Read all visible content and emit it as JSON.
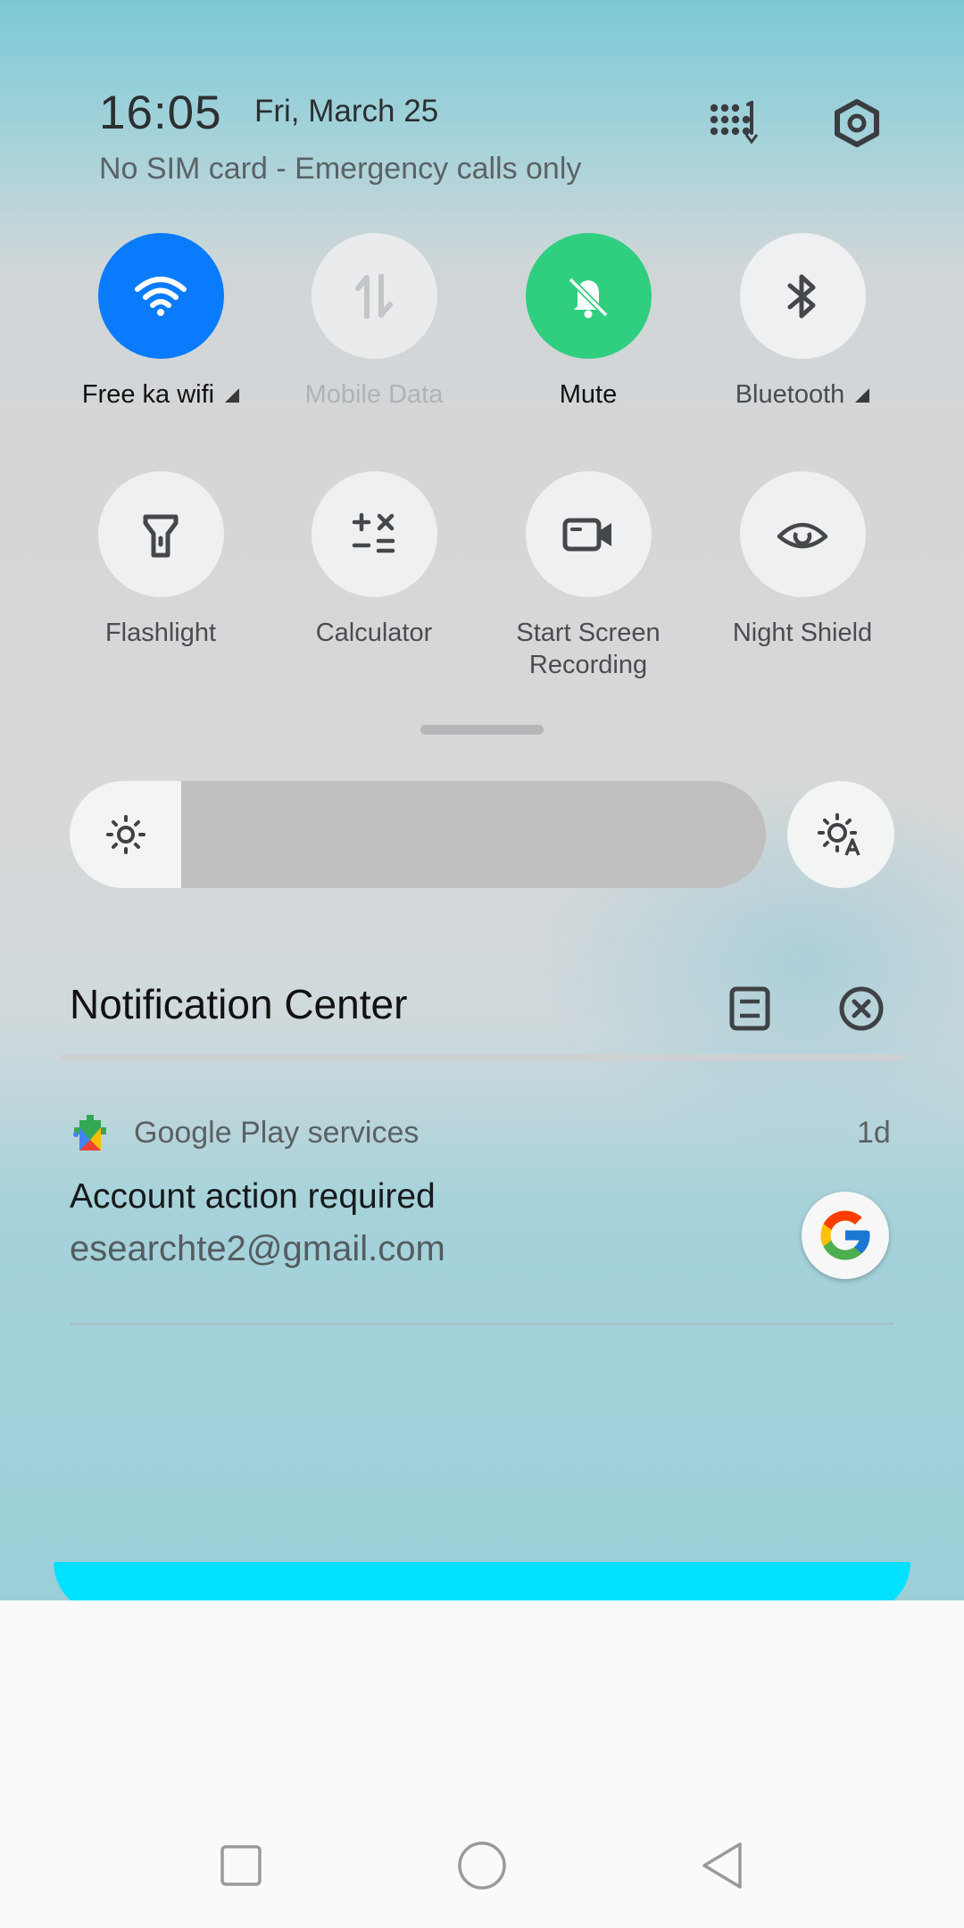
{
  "status": {
    "time": "16:05",
    "date": "Fri, March 25",
    "sim_status": "No SIM card - Emergency calls only"
  },
  "header_icons": [
    "edit-tiles-icon",
    "settings-icon"
  ],
  "tiles": [
    {
      "label": "Free ka wifi",
      "icon": "wifi-icon",
      "active": true,
      "accent": "#0a7bff"
    },
    {
      "label": "Mobile Data",
      "icon": "mobile-data-icon",
      "active": false,
      "disabled": true
    },
    {
      "label": "Mute",
      "icon": "bell-muted-icon",
      "active": true,
      "accent": "#2fcf7f"
    },
    {
      "label": "Bluetooth",
      "icon": "bluetooth-icon",
      "active": false
    },
    {
      "label": "Flashlight",
      "icon": "flashlight-icon",
      "active": false
    },
    {
      "label": "Calculator",
      "icon": "calculator-icon",
      "active": false
    },
    {
      "label": "Start Screen Recording",
      "label_line1": "Start Screen",
      "label_line2": "Recording",
      "icon": "screen-record-icon",
      "active": false
    },
    {
      "label": "Night Shield",
      "icon": "eye-icon",
      "active": false
    }
  ],
  "brightness": {
    "level": 0.16,
    "auto_icon": "auto-brightness-icon"
  },
  "notification_center": {
    "title": "Notification Center",
    "icons": [
      "manage-notifications-icon",
      "clear-all-icon"
    ]
  },
  "notification": {
    "app": "Google Play services",
    "age": "1d",
    "title": "Account action required",
    "text": "esearchte2@gmail.com",
    "large_icon": "google-g-icon"
  },
  "navbar": [
    "recents-button",
    "home-button",
    "back-button"
  ]
}
